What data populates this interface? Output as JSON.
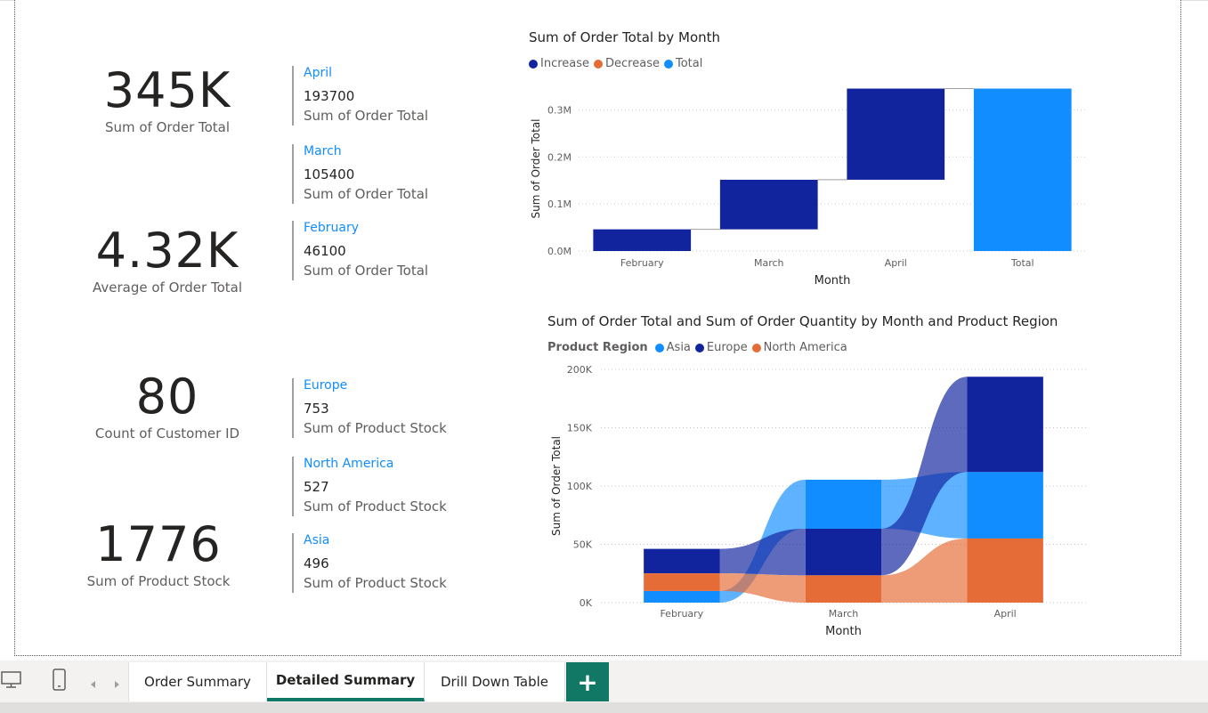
{
  "kpis": [
    {
      "value": "345K",
      "label": "Sum of Order Total"
    },
    {
      "value": "4.32K",
      "label": "Average of Order Total"
    },
    {
      "value": "80",
      "label": "Count of Customer ID"
    },
    {
      "value": "1776",
      "label": "Sum of Product Stock"
    }
  ],
  "order_rows": [
    {
      "title": "April",
      "value": "193700",
      "label": "Sum of Order Total"
    },
    {
      "title": "March",
      "value": "105400",
      "label": "Sum of Order Total"
    },
    {
      "title": "February",
      "value": "46100",
      "label": "Sum of Order Total"
    }
  ],
  "stock_rows": [
    {
      "title": "Europe",
      "value": "753",
      "label": "Sum of Product Stock"
    },
    {
      "title": "North America",
      "value": "527",
      "label": "Sum of Product Stock"
    },
    {
      "title": "Asia",
      "value": "496",
      "label": "Sum of Product Stock"
    }
  ],
  "waterfall": {
    "title": "Sum of Order Total by Month",
    "legend": [
      {
        "label": "Increase",
        "color": "#12239e"
      },
      {
        "label": "Decrease",
        "color": "#e66c37"
      },
      {
        "label": "Total",
        "color": "#118dff"
      }
    ],
    "xlabel": "Month",
    "ylabel": "Sum of Order Total",
    "ticks": [
      "0.0M",
      "0.1M",
      "0.2M",
      "0.3M"
    ]
  },
  "ribbon": {
    "title": "Sum of Order Total and Sum of Order Quantity by Month and Product Region",
    "legend_title": "Product Region",
    "legend": [
      {
        "label": "Asia",
        "color": "#118dff"
      },
      {
        "label": "Europe",
        "color": "#12239e"
      },
      {
        "label": "North America",
        "color": "#e66c37"
      }
    ],
    "xlabel": "Month",
    "ylabel": "Sum of Order Total",
    "ticks": [
      "0K",
      "50K",
      "100K",
      "150K",
      "200K"
    ]
  },
  "chart_data": [
    {
      "type": "bar",
      "subtype": "waterfall",
      "title": "Sum of Order Total by Month",
      "xlabel": "Month",
      "ylabel": "Sum of Order Total",
      "categories": [
        "February",
        "March",
        "April",
        "Total"
      ],
      "values": [
        46100,
        105400,
        193700,
        345200
      ],
      "ylim": [
        0,
        350000
      ],
      "grid": true,
      "legend": "top-left"
    },
    {
      "type": "bar",
      "subtype": "ribbon",
      "title": "Sum of Order Total and Sum of Order Quantity by Month and Product Region",
      "xlabel": "Month",
      "ylabel": "Sum of Order Total",
      "categories": [
        "February",
        "March",
        "April"
      ],
      "series": [
        {
          "name": "Asia",
          "values": [
            10000,
            42000,
            57000
          ]
        },
        {
          "name": "Europe",
          "values": [
            21000,
            40000,
            81700
          ]
        },
        {
          "name": "North America",
          "values": [
            15100,
            23400,
            55000
          ]
        }
      ],
      "ylim": [
        0,
        200000
      ],
      "grid": true,
      "legend": "top-left"
    }
  ],
  "tabs": [
    {
      "label": "Order Summary",
      "active": false
    },
    {
      "label": "Detailed Summary",
      "active": true
    },
    {
      "label": "Drill Down Table",
      "active": false
    }
  ],
  "add_tab": "+",
  "icons": [
    "desktop-icon",
    "phone-icon",
    "prev-page-icon",
    "next-page-icon",
    "add-page-icon"
  ]
}
